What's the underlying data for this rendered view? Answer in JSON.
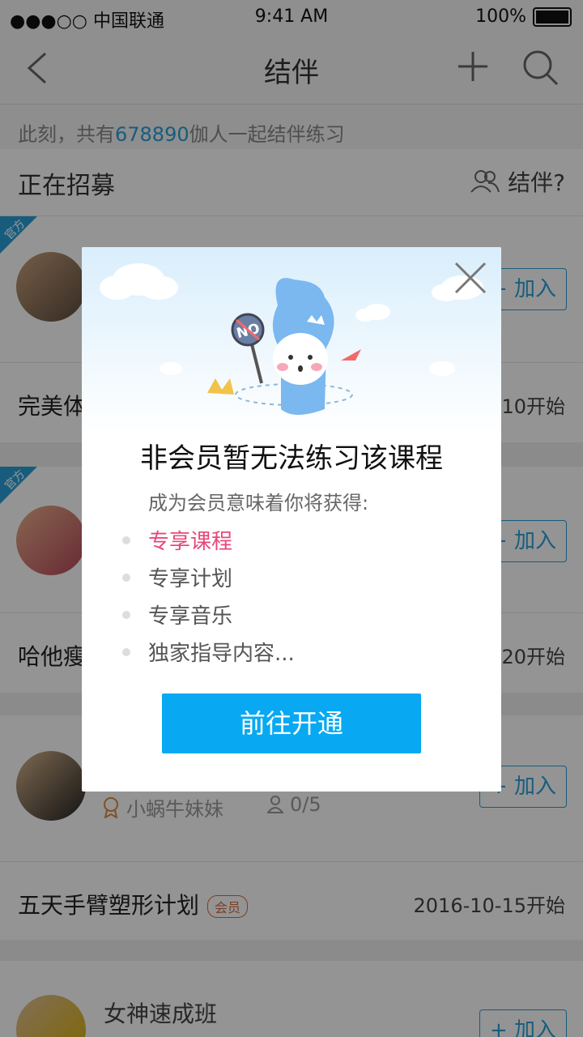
{
  "status_bar": {
    "carrier": "●●●○○ 中国联通",
    "time": "9:41 AM",
    "battery": "100%"
  },
  "nav": {
    "title": "结伴"
  },
  "stats": {
    "prefix": "此刻，共有",
    "count": "678890",
    "suffix": "伽人一起结伴练习"
  },
  "section": {
    "title": "正在招募",
    "help": "结伴?"
  },
  "cards": [
    {
      "official": "官方",
      "join": "+ 加入"
    },
    {
      "title_partial": "完美体",
      "date_partial": "10开始"
    },
    {
      "official": "官方",
      "join": "+ 加入"
    },
    {
      "title_partial": "哈他瘦",
      "date_partial": "20开始"
    },
    {
      "organizer": "小蜗牛妹妹",
      "count": "0/5",
      "join": "+ 加入"
    },
    {
      "title": "五天手臂塑形计划",
      "badge": "会员",
      "date": "2016-10-15开始"
    },
    {
      "title": "女神速成班",
      "join": "+ 加入"
    }
  ],
  "modal": {
    "sign_text": "NO",
    "title": "非会员暂无法练习该课程",
    "subtitle": "成为会员意味着你将获得:",
    "benefits": [
      "专享课程",
      "专享计划",
      "专享音乐",
      "独家指导内容..."
    ],
    "cta": "前往开通"
  },
  "colors": {
    "accent": "#2a9fd8",
    "cta": "#08a9f2",
    "highlight": "#e8487a"
  }
}
